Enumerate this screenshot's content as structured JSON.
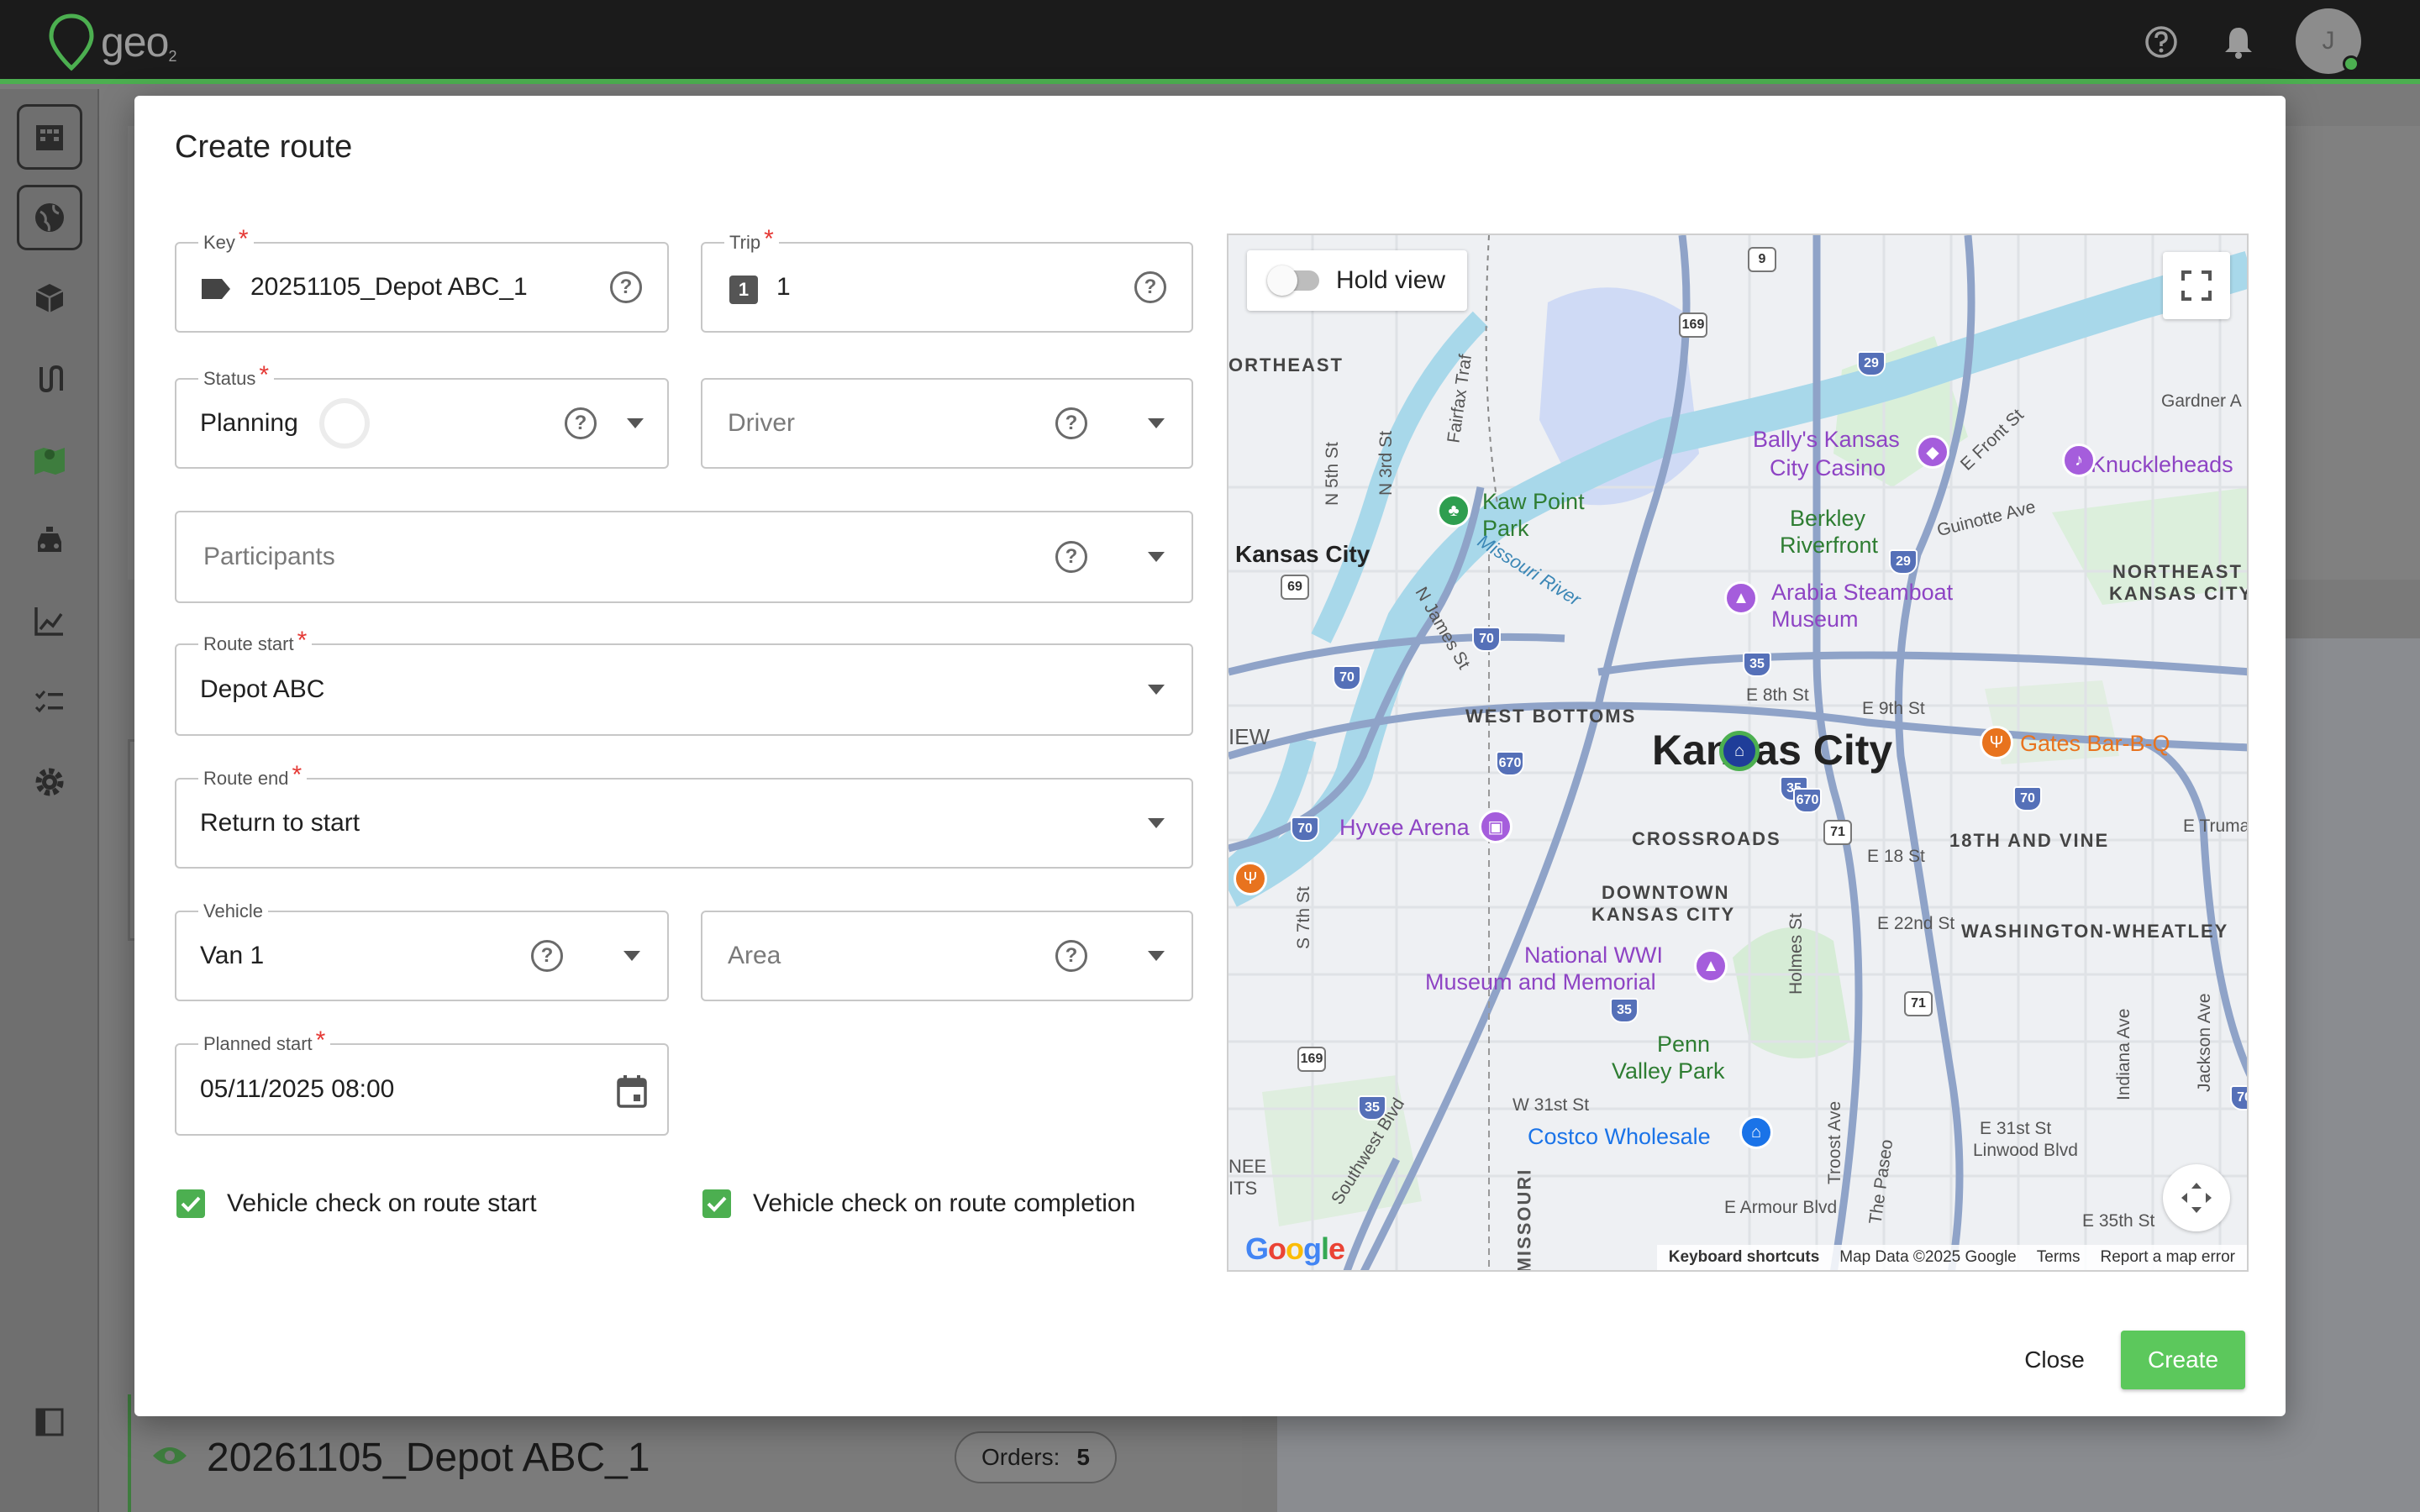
{
  "app": {
    "logo_text": "geo",
    "logo_sub": "2",
    "user_initial": "J"
  },
  "background": {
    "route_title": "20261105_Depot ABC_1",
    "orders_label": "Orders:",
    "orders_count": "5"
  },
  "modal": {
    "title": "Create route",
    "key": {
      "label": "Key",
      "value": "20251105_Depot ABC_1"
    },
    "trip": {
      "label": "Trip",
      "value": "1",
      "badge": "1"
    },
    "status": {
      "label": "Status",
      "value": "Planning"
    },
    "driver": {
      "placeholder": "Driver"
    },
    "participants": {
      "placeholder": "Participants"
    },
    "route_start": {
      "label": "Route start",
      "value": "Depot ABC"
    },
    "route_end": {
      "label": "Route end",
      "value": "Return to start"
    },
    "vehicle": {
      "label": "Vehicle",
      "value": "Van 1"
    },
    "area": {
      "placeholder": "Area"
    },
    "planned_start": {
      "label": "Planned start",
      "value": "05/11/2025 08:00"
    },
    "check_start": {
      "label": "Vehicle check on route start",
      "checked": true
    },
    "check_completion": {
      "label": "Vehicle check on route completion",
      "checked": true
    },
    "help_glyph": "?",
    "close_label": "Close",
    "create_label": "Create"
  },
  "map": {
    "hold_view_label": "Hold view",
    "attribution": {
      "keyboard": "Keyboard shortcuts",
      "data": "Map Data ©2025 Google",
      "terms": "Terms",
      "report": "Report a map error"
    },
    "google": "Google",
    "labels": {
      "kansas_city_big": "Kansas City",
      "kansas_city_left": "Kansas City",
      "northeast": "ORTHEAST",
      "west_bottoms": "WEST BOTTOMS",
      "crossroads": "CROSSROADS",
      "downtown_1": "DOWNTOWN",
      "downtown_2": "KANSAS CITY",
      "eighteenth_vine": "18TH AND VINE",
      "washington": "WASHINGTON-WHEATLEY",
      "ne_kc_1": "NORTHEAST",
      "ne_kc_2": "KANSAS CITY",
      "kaw_point_1": "Kaw Point",
      "kaw_point_2": "Park",
      "ballys_1": "Bally's Kansas",
      "ballys_2": "City Casino",
      "knuckleheads": "Knuckleheads",
      "berkley_1": "Berkley",
      "berkley_2": "Riverfront",
      "arabia_1": "Arabia Steamboat",
      "arabia_2": "Museum",
      "gates": "Gates Bar-B-Q",
      "hyvee": "Hyvee Arena",
      "wwi_1": "National WWI",
      "wwi_2": "Museum and Memorial",
      "penn_1": "Penn",
      "penn_2": "Valley Park",
      "costco": "Costco Wholesale",
      "missouri_river": "Missouri River",
      "missouri": "MISSOURI",
      "e8th": "E 8th St",
      "e9th": "E 9th St",
      "e18th": "E 18 St",
      "e22nd": "E 22nd St",
      "w31st": "W 31st St",
      "e31st": "E 31st St",
      "linwood": "Linwood Blvd",
      "e35th": "E 35th St",
      "armour": "E Armour Blvd",
      "guinotte": "Guinotte Ave",
      "efront": "E Front St",
      "gardner": "Gardner A",
      "n5th": "N 5th St",
      "n3rd": "N 3rd St",
      "fairfax": "Fairfax Traf",
      "njames": "N James St",
      "s7th": "S 7th St",
      "holmes": "Holmes St",
      "troost": "Troost Ave",
      "paseo": "The Paseo",
      "indiana": "Indiana Ave",
      "jackson": "Jackson Ave",
      "southwest": "Southwest Blvd",
      "etruma": "E Truma",
      "iew": "IEW",
      "nee": "NEE",
      "its": "ITS"
    },
    "shields": [
      "9",
      "169",
      "29",
      "69",
      "70",
      "35",
      "670",
      "70",
      "35",
      "70",
      "71",
      "670",
      "70",
      "35",
      "71",
      "169",
      "35",
      "70",
      "29"
    ]
  },
  "colors": {
    "accent": "#4caf50",
    "create_button": "#5cc85c",
    "required": "#e53935"
  }
}
